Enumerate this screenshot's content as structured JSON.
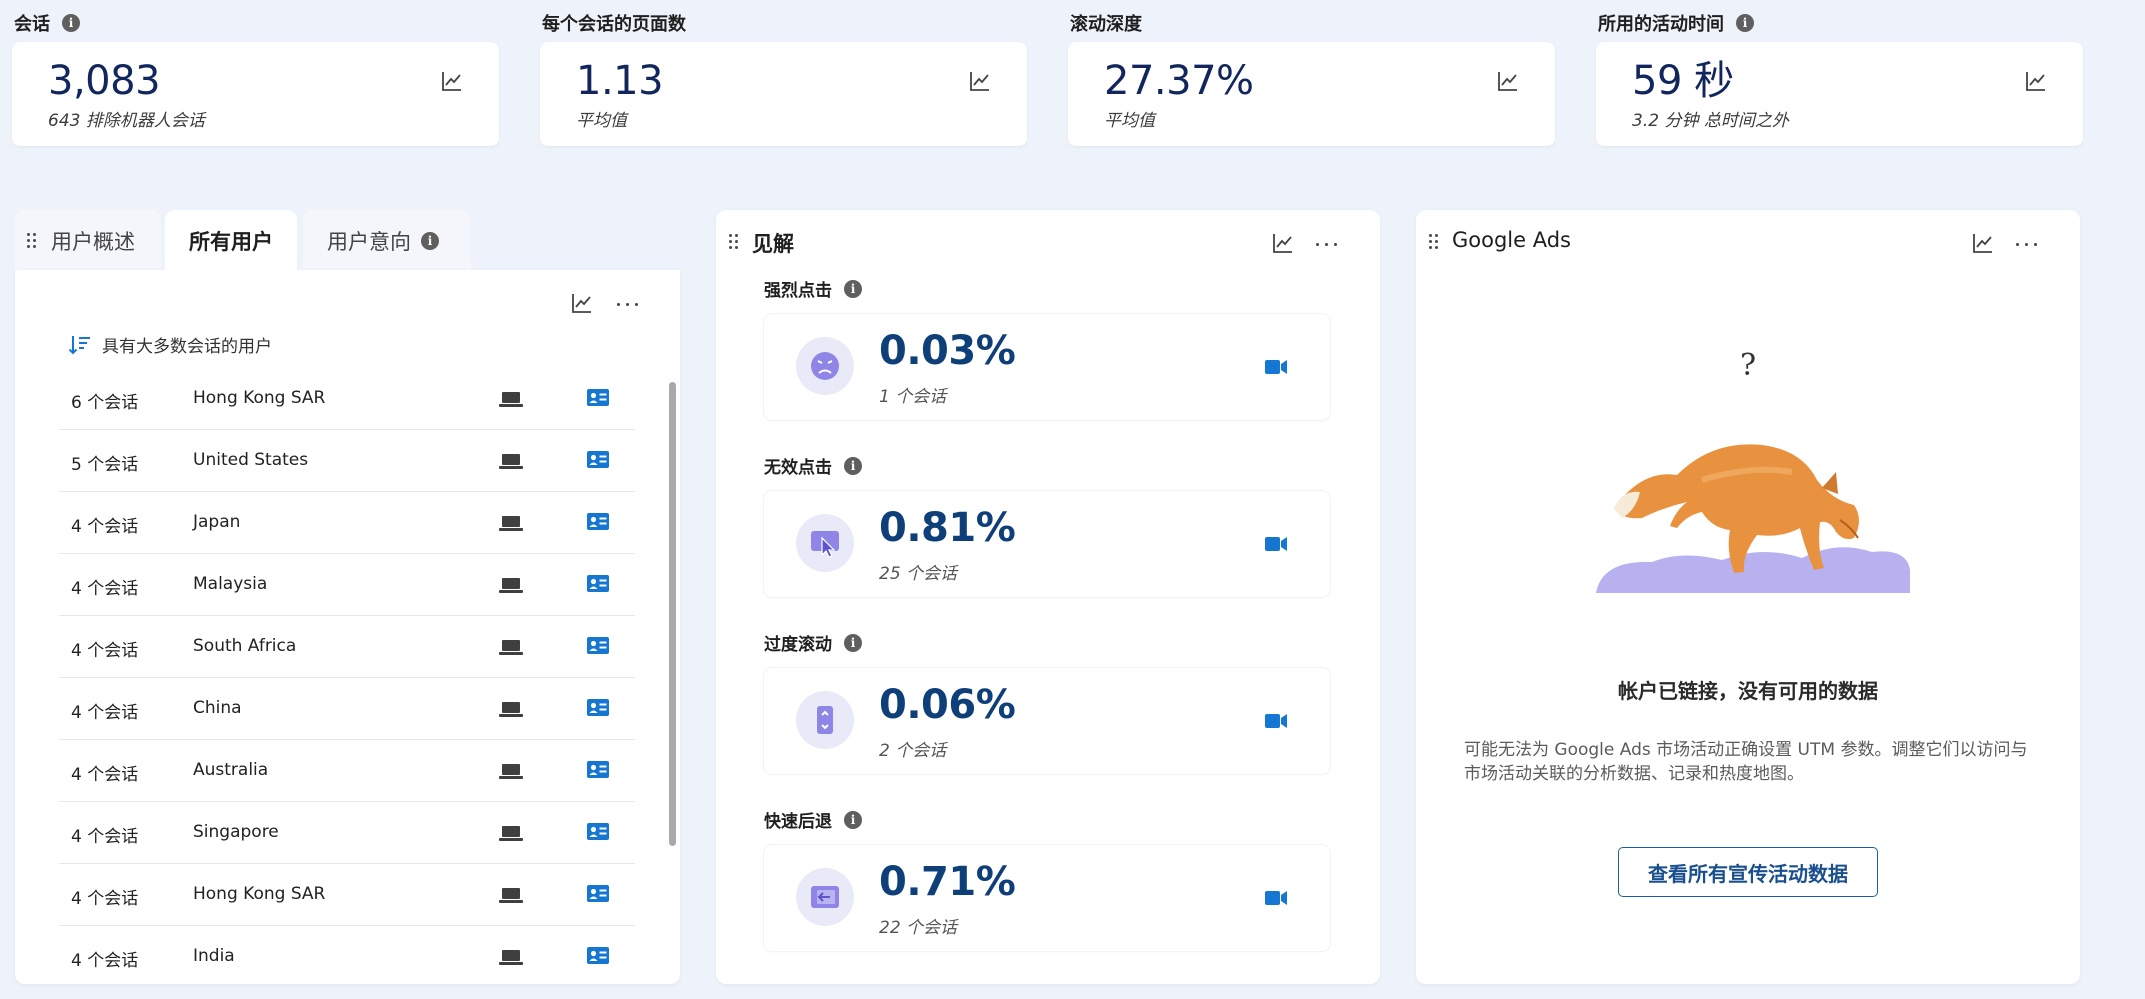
{
  "metrics": [
    {
      "title": "会话",
      "has_info": true,
      "value": "3,083",
      "sub": "643 排除机器人会话"
    },
    {
      "title": "每个会话的页面数",
      "has_info": false,
      "value": "1.13",
      "sub": "平均值"
    },
    {
      "title": "滚动深度",
      "has_info": false,
      "value": "27.37%",
      "sub": "平均值"
    },
    {
      "title": "所用的活动时间",
      "has_info": true,
      "value": "59 秒",
      "sub": "3.2 分钟 总时间之外"
    }
  ],
  "info_glyph": "i",
  "users_panel": {
    "tabs": [
      "用户概述",
      "所有用户",
      "用户意向"
    ],
    "active_tab": 1,
    "sort_label": "具有大多数会话的用户",
    "rows": [
      {
        "sessions": "6 个会话",
        "country": "Hong Kong SAR"
      },
      {
        "sessions": "5 个会话",
        "country": "United States"
      },
      {
        "sessions": "4 个会话",
        "country": "Japan"
      },
      {
        "sessions": "4 个会话",
        "country": "Malaysia"
      },
      {
        "sessions": "4 个会话",
        "country": "South Africa"
      },
      {
        "sessions": "4 个会话",
        "country": "China"
      },
      {
        "sessions": "4 个会话",
        "country": "Australia"
      },
      {
        "sessions": "4 个会话",
        "country": "Singapore"
      },
      {
        "sessions": "4 个会话",
        "country": "Hong Kong SAR"
      },
      {
        "sessions": "4 个会话",
        "country": "India"
      }
    ]
  },
  "insights_panel": {
    "title": "见解",
    "items": [
      {
        "label": "强烈点击",
        "value": "0.03%",
        "sub": "1 个会话",
        "icon": "angry-face-icon"
      },
      {
        "label": "无效点击",
        "value": "0.81%",
        "sub": "25 个会话",
        "icon": "dead-click-icon"
      },
      {
        "label": "过度滚动",
        "value": "0.06%",
        "sub": "2 个会话",
        "icon": "scroll-icon"
      },
      {
        "label": "快速后退",
        "value": "0.71%",
        "sub": "22 个会话",
        "icon": "back-icon"
      }
    ]
  },
  "ads_panel": {
    "title": "Google Ads",
    "question_mark": "?",
    "heading": "帐户已链接，没有可用的数据",
    "description": "可能无法为 Google Ads 市场活动正确设置 UTM 参数。调整它们以访问与市场活动关联的分析数据、记录和热度地图。",
    "button_label": "查看所有宣传活动数据"
  },
  "colors": {
    "page_bg": "#eef3fb",
    "metric_value": "#11265c",
    "insight_value": "#0f3f78",
    "accent_blue": "#1677d2",
    "icon_purple": "#8e85e6"
  }
}
